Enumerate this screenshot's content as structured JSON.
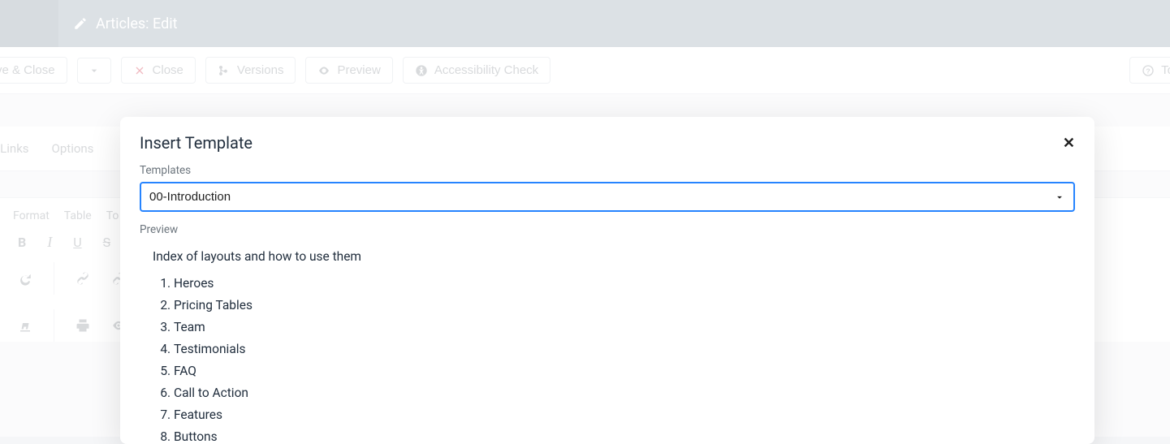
{
  "header": {
    "title": "Articles: Edit"
  },
  "toolbar": {
    "save_close": "ve & Close",
    "close": "Close",
    "versions": "Versions",
    "preview": "Preview",
    "accessibility": "Accessibility Check",
    "toggle": "To"
  },
  "tabs": {
    "links": "d Links",
    "options": "Options"
  },
  "editor_menu": {
    "format": "Format",
    "table": "Table",
    "tools": "To"
  },
  "modal": {
    "title": "Insert Template",
    "templates_label": "Templates",
    "selected": "00-Introduction",
    "preview_label": "Preview",
    "preview_intro": "Index of layouts and how to use them",
    "items": {
      "0": "Heroes",
      "1": "Pricing Tables",
      "2": "Team",
      "3": "Testimonials",
      "4": "FAQ",
      "5": "Call to Action",
      "6": "Features",
      "7": "Buttons"
    }
  }
}
